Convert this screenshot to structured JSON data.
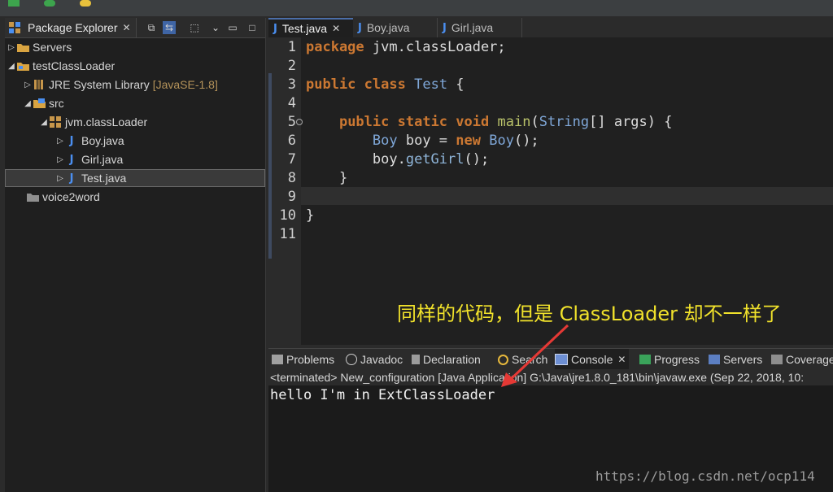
{
  "package_explorer": {
    "tab_label": "Package Explorer",
    "tree": [
      {
        "label": "Servers",
        "icon": "folder-icon"
      },
      {
        "label": "testClassLoader",
        "icon": "project-icon"
      },
      {
        "label": "JRE System Library",
        "badge": "[JavaSE-1.8]",
        "icon": "library-icon"
      },
      {
        "label": "src",
        "icon": "source-folder-icon"
      },
      {
        "label": "jvm.classLoader",
        "icon": "package-icon"
      },
      {
        "label": "Boy.java",
        "icon": "java-file-icon"
      },
      {
        "label": "Girl.java",
        "icon": "java-file-icon"
      },
      {
        "label": "Test.java",
        "icon": "java-file-icon"
      },
      {
        "label": "voice2word",
        "icon": "closed-project-icon"
      }
    ]
  },
  "editor": {
    "tabs": [
      "Test.java",
      "Boy.java",
      "Girl.java"
    ],
    "active_tab": "Test.java",
    "line_numbers": [
      "1",
      "2",
      "3",
      "4",
      "5",
      "6",
      "7",
      "8",
      "9",
      "10",
      "11"
    ],
    "code": [
      "package jvm.classLoader;",
      "",
      "public class Test {",
      "",
      "    public static void main(String[] args) {",
      "        Boy boy = new Boy();",
      "        boy.getGirl();",
      "    }",
      "",
      "}",
      ""
    ]
  },
  "annotation": "同样的代码，但是 ClassLoader 却不一样了",
  "console_tabs": [
    "Problems",
    "Javadoc",
    "Declaration",
    "Search",
    "Console",
    "Progress",
    "Servers",
    "Coverage"
  ],
  "console": {
    "active_tab": "Console",
    "status": "<terminated> New_configuration [Java Application] G:\\Java\\jre1.8.0_181\\bin\\javaw.exe (Sep 22, 2018, 10:",
    "output": "hello I'm in ExtClassLoader"
  },
  "watermark": "https://blog.csdn.net/ocp114",
  "colors": {
    "annotation": "#f1e22b",
    "keyword": "#cc7832",
    "arrow": "#e53935",
    "java_icon": "#4b8ff0"
  }
}
